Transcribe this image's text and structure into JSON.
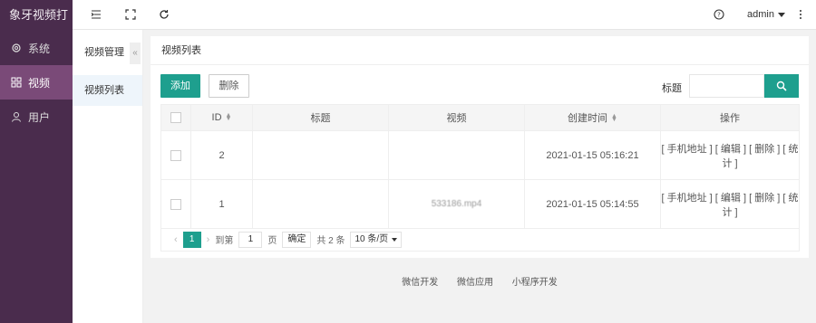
{
  "app": {
    "title": "象牙视频打"
  },
  "sidebar": {
    "items": [
      {
        "label": "系统",
        "icon": "gear-icon"
      },
      {
        "label": "视频",
        "icon": "grid-icon"
      },
      {
        "label": "用户",
        "icon": "user-icon"
      }
    ]
  },
  "topbar": {
    "user": "admin"
  },
  "subnav": {
    "title": "视频管理",
    "items": [
      {
        "label": "视频列表"
      }
    ]
  },
  "panel": {
    "title": "视频列表",
    "add_label": "添加",
    "delete_label": "删除",
    "search_label": "标题",
    "search_placeholder": ""
  },
  "table": {
    "headers": [
      "ID",
      "标题",
      "视频",
      "创建时间",
      "操作"
    ],
    "rows": [
      {
        "id": "2",
        "title": "",
        "video": "",
        "created": "2021-01-15 05:16:21",
        "actions": "[ 手机地址 ] [ 编辑 ] [ 删除 ] [ 统计 ]"
      },
      {
        "id": "1",
        "title": "",
        "video": "533186.mp4",
        "created": "2021-01-15 05:14:55",
        "actions": "[ 手机地址 ] [ 编辑 ] [ 删除 ] [ 统计 ]"
      }
    ]
  },
  "pagination": {
    "current": "1",
    "goto_label": "到第",
    "page_value": "1",
    "page_unit": "页",
    "confirm_label": "确定",
    "total_label": "共 2 条",
    "per_page": "10 条/页"
  },
  "footer": {
    "links": [
      "微信开发",
      "微信应用",
      "小程序开发"
    ]
  },
  "colors": {
    "sidebar": "#4a2c4d",
    "active": "#7a4a78",
    "accent": "#1e9f8e"
  }
}
